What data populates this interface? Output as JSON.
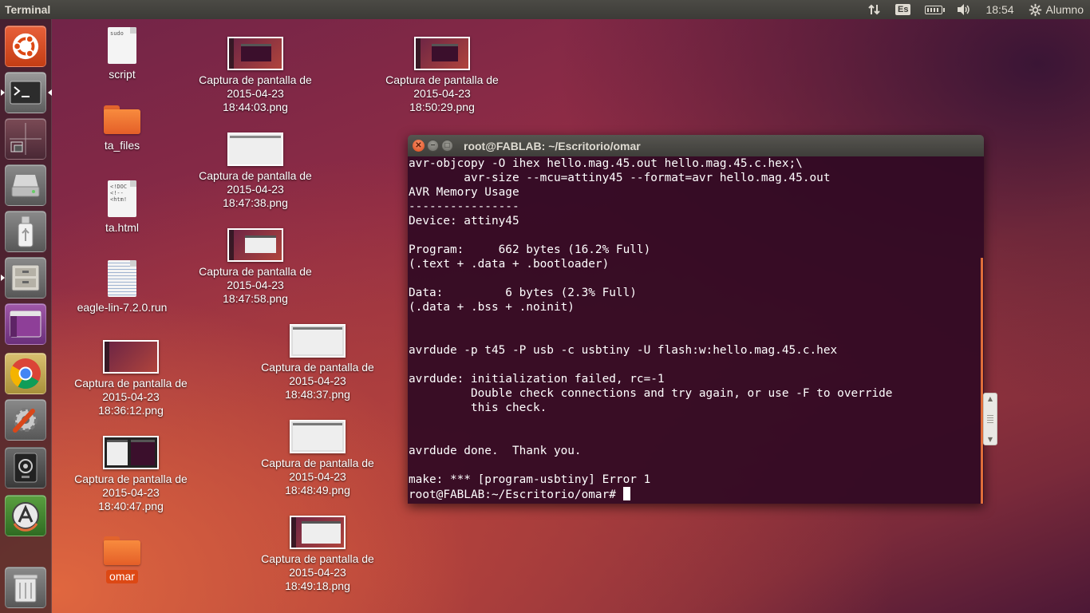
{
  "top_panel": {
    "app_title": "Terminal",
    "keyboard_layout": "Es",
    "clock": "18:54",
    "user_name": "Alumno",
    "icons": [
      "network-arrows-icon",
      "keyboard-layout-icon",
      "battery-icon",
      "volume-icon",
      "gear-icon"
    ]
  },
  "launcher": {
    "items": [
      {
        "name": "ubuntu-dash-icon"
      },
      {
        "name": "terminal-icon",
        "active": true
      },
      {
        "name": "workspace-switcher-icon"
      },
      {
        "name": "hard-drive-icon"
      },
      {
        "name": "usb-drive-icon"
      },
      {
        "name": "files-icon"
      },
      {
        "name": "ubuntu-window-icon"
      },
      {
        "name": "chrome-icon"
      },
      {
        "name": "system-settings-icon"
      },
      {
        "name": "webcam-icon"
      },
      {
        "name": "software-updater-icon"
      },
      {
        "name": "trash-icon"
      }
    ],
    "colors": {
      "ubuntu": "#dd4814",
      "chrome_red": "#db4437",
      "chrome_yellow": "#f4b400",
      "chrome_green": "#0f9d58",
      "chrome_blue": "#4285f4"
    }
  },
  "desktop": {
    "icons": [
      {
        "label": "script",
        "kind": "text-file",
        "preview": "sudo"
      },
      {
        "label": "ta_files",
        "kind": "folder"
      },
      {
        "label": "ta.html",
        "kind": "html-file",
        "preview": "<!DOC\n<!--\n<htm!"
      },
      {
        "label": "eagle-lin-7.2.0.run",
        "kind": "script-file"
      },
      {
        "label": "Captura de pantalla de 2015-04-23 18:36:12.png",
        "kind": "screenshot"
      },
      {
        "label": "Captura de pantalla de 2015-04-23 18:40:47.png",
        "kind": "screenshot"
      },
      {
        "label": "omar",
        "kind": "folder",
        "selected": true
      },
      {
        "label": "Captura de pantalla de 2015-04-23 18:44:03.png",
        "kind": "screenshot"
      },
      {
        "label": "Captura de pantalla de 2015-04-23 18:47:38.png",
        "kind": "screenshot"
      },
      {
        "label": "Captura de pantalla de 2015-04-23 18:47:58.png",
        "kind": "screenshot"
      },
      {
        "label": "Captura de pantalla de 2015-04-23 18:48:37.png",
        "kind": "screenshot"
      },
      {
        "label": "Captura de pantalla de 2015-04-23 18:48:49.png",
        "kind": "screenshot"
      },
      {
        "label": "Captura de pantalla de 2015-04-23 18:49:18.png",
        "kind": "screenshot"
      },
      {
        "label": "Captura de pantalla de 2015-04-23 18:50:29.png",
        "kind": "screenshot"
      }
    ]
  },
  "terminal": {
    "title": "root@FABLAB: ~/Escritorio/omar",
    "lines": [
      "avr-objcopy -O ihex hello.mag.45.out hello.mag.45.c.hex;\\",
      "        avr-size --mcu=attiny45 --format=avr hello.mag.45.out",
      "AVR Memory Usage",
      "----------------",
      "Device: attiny45",
      "",
      "Program:     662 bytes (16.2% Full)",
      "(.text + .data + .bootloader)",
      "",
      "Data:         6 bytes (2.3% Full)",
      "(.data + .bss + .noinit)",
      "",
      "",
      "avrdude -p t45 -P usb -c usbtiny -U flash:w:hello.mag.45.c.hex",
      "",
      "avrdude: initialization failed, rc=-1",
      "         Double check connections and try again, or use -F to override",
      "         this check.",
      "",
      "",
      "avrdude done.  Thank you.",
      "",
      "make: *** [program-usbtiny] Error 1"
    ],
    "prompt": "root@FABLAB:~/Escritorio/omar# ",
    "colors": {
      "background": "#300a24",
      "foreground": "#ffffff",
      "accent": "#e06e3a"
    }
  }
}
